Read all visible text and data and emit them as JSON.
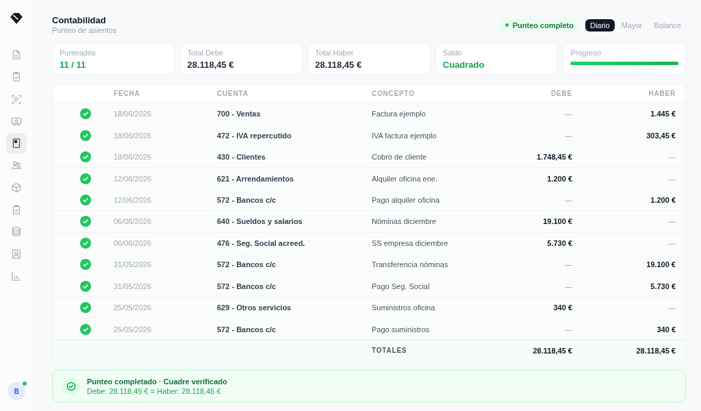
{
  "sidebar": {
    "items": [
      {
        "selected": false
      },
      {
        "selected": false
      },
      {
        "selected": false
      },
      {
        "selected": false
      },
      {
        "selected": true
      },
      {
        "selected": false
      },
      {
        "selected": false
      },
      {
        "selected": false
      },
      {
        "selected": false
      },
      {
        "selected": false
      },
      {
        "selected": false
      }
    ],
    "avatar": {
      "initial": "B",
      "online": true
    }
  },
  "header": {
    "title": "Contabilidad",
    "subtitle": "Punteo de asientos",
    "status": "Punteo completo",
    "tabs": [
      {
        "label": "Diario",
        "selected": true
      },
      {
        "label": "Mayor",
        "selected": false
      },
      {
        "label": "Balance",
        "selected": false
      }
    ]
  },
  "stats": [
    {
      "kind": "success",
      "label": "Punteados",
      "value": "11 / 11"
    },
    {
      "kind": "plain",
      "label": "Total Debe",
      "value": "28.118,45 €"
    },
    {
      "kind": "plain",
      "label": "Total Haber",
      "value": "28.118,45 €"
    },
    {
      "kind": "success",
      "label": "Saldo",
      "value": "Cuadrado"
    },
    {
      "kind": "progress",
      "label": "Progreso",
      "level": 1
    }
  ],
  "table": {
    "columns": [
      "FECHA",
      "CUENTA",
      "CONCEPTO",
      "DEBE",
      "HABER"
    ],
    "rows": [
      {
        "checked": true,
        "kind": "haber",
        "fecha": "18/06/2026",
        "cuenta": "700 - Ventas",
        "concepto": "Factura ejemplo",
        "debe": "—",
        "haber": "1.445 €"
      },
      {
        "checked": true,
        "kind": "haber",
        "fecha": "18/06/2026",
        "cuenta": "472 - IVA repercutido",
        "concepto": "IVA factura ejemplo",
        "debe": "—",
        "haber": "303,45 €"
      },
      {
        "checked": true,
        "kind": "debe",
        "fecha": "18/06/2026",
        "cuenta": "430 - Clientes",
        "concepto": "Cobro de cliente",
        "debe": "1.748,45 €",
        "haber": "—"
      },
      {
        "checked": true,
        "kind": "debe",
        "fecha": "12/06/2026",
        "cuenta": "621 - Arrendamientos",
        "concepto": "Alquiler oficina ene.",
        "debe": "1.200 €",
        "haber": "—"
      },
      {
        "checked": true,
        "kind": "haber",
        "fecha": "12/06/2026",
        "cuenta": "572 - Bancos c/c",
        "concepto": "Pago alquiler oficina",
        "debe": "—",
        "haber": "1.200 €"
      },
      {
        "checked": true,
        "kind": "debe",
        "fecha": "06/06/2026",
        "cuenta": "640 - Sueldos y salarios",
        "concepto": "Nóminas diciembre",
        "debe": "19.100 €",
        "haber": "—"
      },
      {
        "checked": true,
        "kind": "debe",
        "fecha": "06/06/2026",
        "cuenta": "476 - Seg. Social acreed.",
        "concepto": "SS empresa diciembre",
        "debe": "5.730 €",
        "haber": "—"
      },
      {
        "checked": true,
        "kind": "haber",
        "fecha": "31/05/2026",
        "cuenta": "572 - Bancos c/c",
        "concepto": "Transferencia nóminas",
        "debe": "—",
        "haber": "19.100 €"
      },
      {
        "checked": true,
        "kind": "haber",
        "fecha": "31/05/2026",
        "cuenta": "572 - Bancos c/c",
        "concepto": "Pago Seg. Social",
        "debe": "—",
        "haber": "5.730 €"
      },
      {
        "checked": true,
        "kind": "debe",
        "fecha": "25/05/2026",
        "cuenta": "629 - Otros servicios",
        "concepto": "Suministros oficina",
        "debe": "340 €",
        "haber": "—"
      },
      {
        "checked": true,
        "kind": "haber",
        "fecha": "25/05/2026",
        "cuenta": "572 - Bancos c/c",
        "concepto": "Pago suministros",
        "debe": "—",
        "haber": "340 €"
      }
    ],
    "totals": {
      "label": "TOTALES",
      "debe": "28.118,45 €",
      "haber": "28.118,45 €"
    }
  },
  "banner": {
    "title": "Punteo completado · Cuadre verificado",
    "detail": "Debe: 28.118,45 € = Haber: 28.118,45 €"
  }
}
